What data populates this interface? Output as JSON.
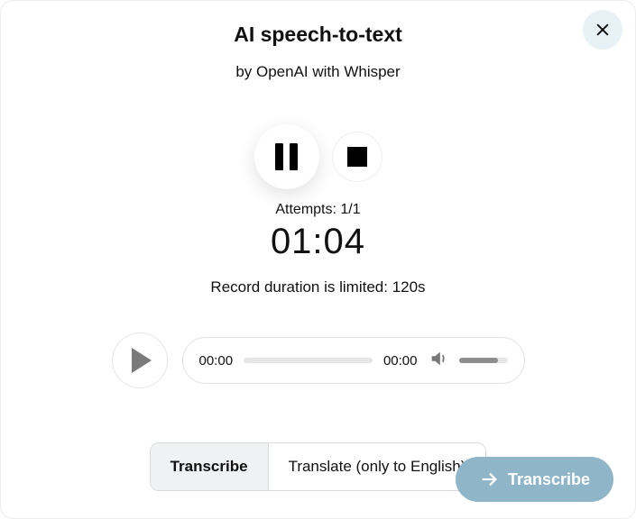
{
  "header": {
    "title": "AI speech-to-text",
    "subtitle": "by OpenAI with Whisper"
  },
  "recorder": {
    "attempts_label": "Attempts: ",
    "attempts_value": "1/1",
    "timer": "01:04",
    "limit_label": "Record duration is limited: ",
    "limit_value": "120s"
  },
  "player": {
    "current_time": "00:00",
    "total_time": "00:00"
  },
  "tabs": {
    "transcribe": "Transcribe",
    "translate": "Translate (only to English)"
  },
  "actions": {
    "submit_label": "Transcribe"
  }
}
